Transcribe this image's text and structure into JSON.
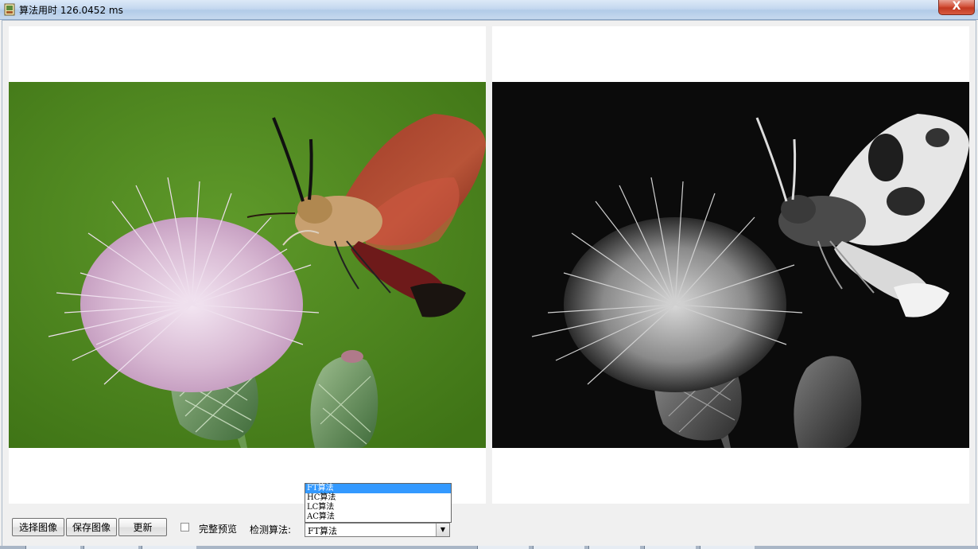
{
  "window": {
    "title": "算法用时 126.0452 ms",
    "close_label": "X"
  },
  "controls": {
    "select_image": "选择图像",
    "save_image": "保存图像",
    "update": "更新",
    "full_preview_label": "完整预览",
    "full_preview_checked": false,
    "algorithm_label": "检测算法:",
    "algorithm_value": "FT算法",
    "algorithm_options": [
      "FT算法",
      "HC算法",
      "LC算法",
      "AC算法"
    ],
    "highlighted_option": "FT算法"
  },
  "images": {
    "left": "original-photo",
    "right": "saliency-map"
  },
  "colors": {
    "selection": "#3399ff",
    "close_button": "#c23a22"
  }
}
